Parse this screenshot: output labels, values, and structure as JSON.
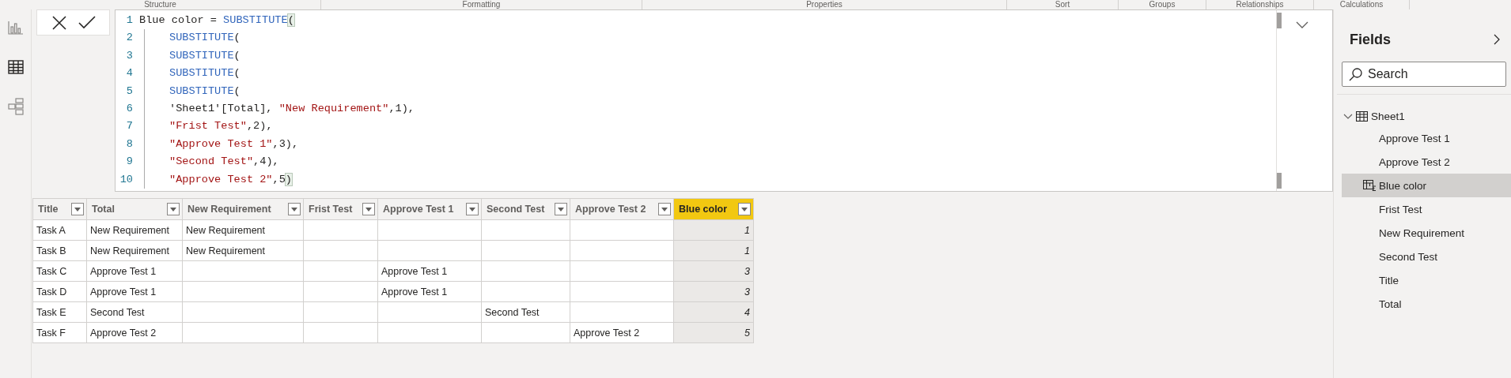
{
  "ribbon_groups": [
    "Structure",
    "Formatting",
    "Properties",
    "Sort",
    "Groups",
    "Relationships",
    "Calculations"
  ],
  "views": [
    {
      "kind": "report",
      "selected": false
    },
    {
      "kind": "data",
      "selected": true
    },
    {
      "kind": "model",
      "selected": false
    }
  ],
  "formula": {
    "lines": [
      {
        "number": "1",
        "indent": false,
        "tokens": [
          {
            "kind": "plain",
            "text": "Blue color = "
          },
          {
            "kind": "function",
            "text": "SUBSTITUTE"
          },
          {
            "kind": "match",
            "text": "("
          }
        ]
      },
      {
        "number": "2",
        "indent": true,
        "tokens": [
          {
            "kind": "function",
            "text": "SUBSTITUTE"
          },
          {
            "kind": "plain",
            "text": "("
          }
        ]
      },
      {
        "number": "3",
        "indent": true,
        "tokens": [
          {
            "kind": "function",
            "text": "SUBSTITUTE"
          },
          {
            "kind": "plain",
            "text": "("
          }
        ]
      },
      {
        "number": "4",
        "indent": true,
        "tokens": [
          {
            "kind": "function",
            "text": "SUBSTITUTE"
          },
          {
            "kind": "plain",
            "text": "("
          }
        ]
      },
      {
        "number": "5",
        "indent": true,
        "tokens": [
          {
            "kind": "function",
            "text": "SUBSTITUTE"
          },
          {
            "kind": "plain",
            "text": "("
          }
        ]
      },
      {
        "number": "6",
        "indent": true,
        "tokens": [
          {
            "kind": "plain",
            "text": "'Sheet1'[Total], "
          },
          {
            "kind": "string",
            "text": "\"New Requirement\""
          },
          {
            "kind": "plain",
            "text": ",1),"
          }
        ]
      },
      {
        "number": "7",
        "indent": true,
        "tokens": [
          {
            "kind": "string",
            "text": "\"Frist Test\""
          },
          {
            "kind": "plain",
            "text": ",2),"
          }
        ]
      },
      {
        "number": "8",
        "indent": true,
        "tokens": [
          {
            "kind": "string",
            "text": "\"Approve Test 1\""
          },
          {
            "kind": "plain",
            "text": ",3),"
          }
        ]
      },
      {
        "number": "9",
        "indent": true,
        "tokens": [
          {
            "kind": "string",
            "text": "\"Second Test\""
          },
          {
            "kind": "plain",
            "text": ",4),"
          }
        ]
      },
      {
        "number": "10",
        "indent": true,
        "tokens": [
          {
            "kind": "string",
            "text": "\"Approve Test 2\""
          },
          {
            "kind": "plain",
            "text": ",5"
          },
          {
            "kind": "match",
            "text": ")"
          }
        ]
      }
    ]
  },
  "table": {
    "columns": [
      {
        "label": "Title",
        "kind": "text",
        "selected": false
      },
      {
        "label": "Total",
        "kind": "text",
        "selected": false
      },
      {
        "label": "New Requirement",
        "kind": "text",
        "selected": false
      },
      {
        "label": "Frist Test",
        "kind": "text",
        "selected": false
      },
      {
        "label": "Approve Test 1",
        "kind": "text",
        "selected": false
      },
      {
        "label": "Second Test",
        "kind": "text",
        "selected": false
      },
      {
        "label": "Approve Test 2",
        "kind": "text",
        "selected": false
      },
      {
        "label": "Blue color",
        "kind": "calculated",
        "selected": true
      }
    ],
    "rows": [
      {
        "cells": [
          "Task A",
          "New Requirement",
          "New Requirement",
          null,
          null,
          null,
          null,
          "1"
        ]
      },
      {
        "cells": [
          "Task B",
          "New Requirement",
          "New Requirement",
          null,
          null,
          null,
          null,
          "1"
        ]
      },
      {
        "cells": [
          "Task C",
          "Approve Test 1",
          null,
          null,
          "Approve Test 1",
          null,
          null,
          "3"
        ]
      },
      {
        "cells": [
          "Task D",
          "Approve Test 1",
          null,
          null,
          "Approve Test 1",
          null,
          null,
          "3"
        ]
      },
      {
        "cells": [
          "Task E",
          "Second Test",
          null,
          null,
          null,
          "Second Test",
          null,
          "4"
        ]
      },
      {
        "cells": [
          "Task F",
          "Approve Test 2",
          null,
          null,
          null,
          null,
          "Approve Test 2",
          "5"
        ]
      }
    ]
  },
  "fields": {
    "title": "Fields",
    "search": {
      "placeholder": "Search"
    },
    "tables": [
      {
        "label": "Sheet1",
        "expanded": true,
        "children": [
          {
            "label": "Approve Test 1",
            "kind": "column",
            "selected": false
          },
          {
            "label": "Approve Test 2",
            "kind": "column",
            "selected": false
          },
          {
            "label": "Blue color",
            "kind": "calculated",
            "selected": true
          },
          {
            "label": "Frist Test",
            "kind": "column",
            "selected": false
          },
          {
            "label": "New Requirement",
            "kind": "column",
            "selected": false
          },
          {
            "label": "Second Test",
            "kind": "column",
            "selected": false
          },
          {
            "label": "Title",
            "kind": "column",
            "selected": false
          },
          {
            "label": "Total",
            "kind": "column",
            "selected": false
          }
        ]
      }
    ]
  }
}
